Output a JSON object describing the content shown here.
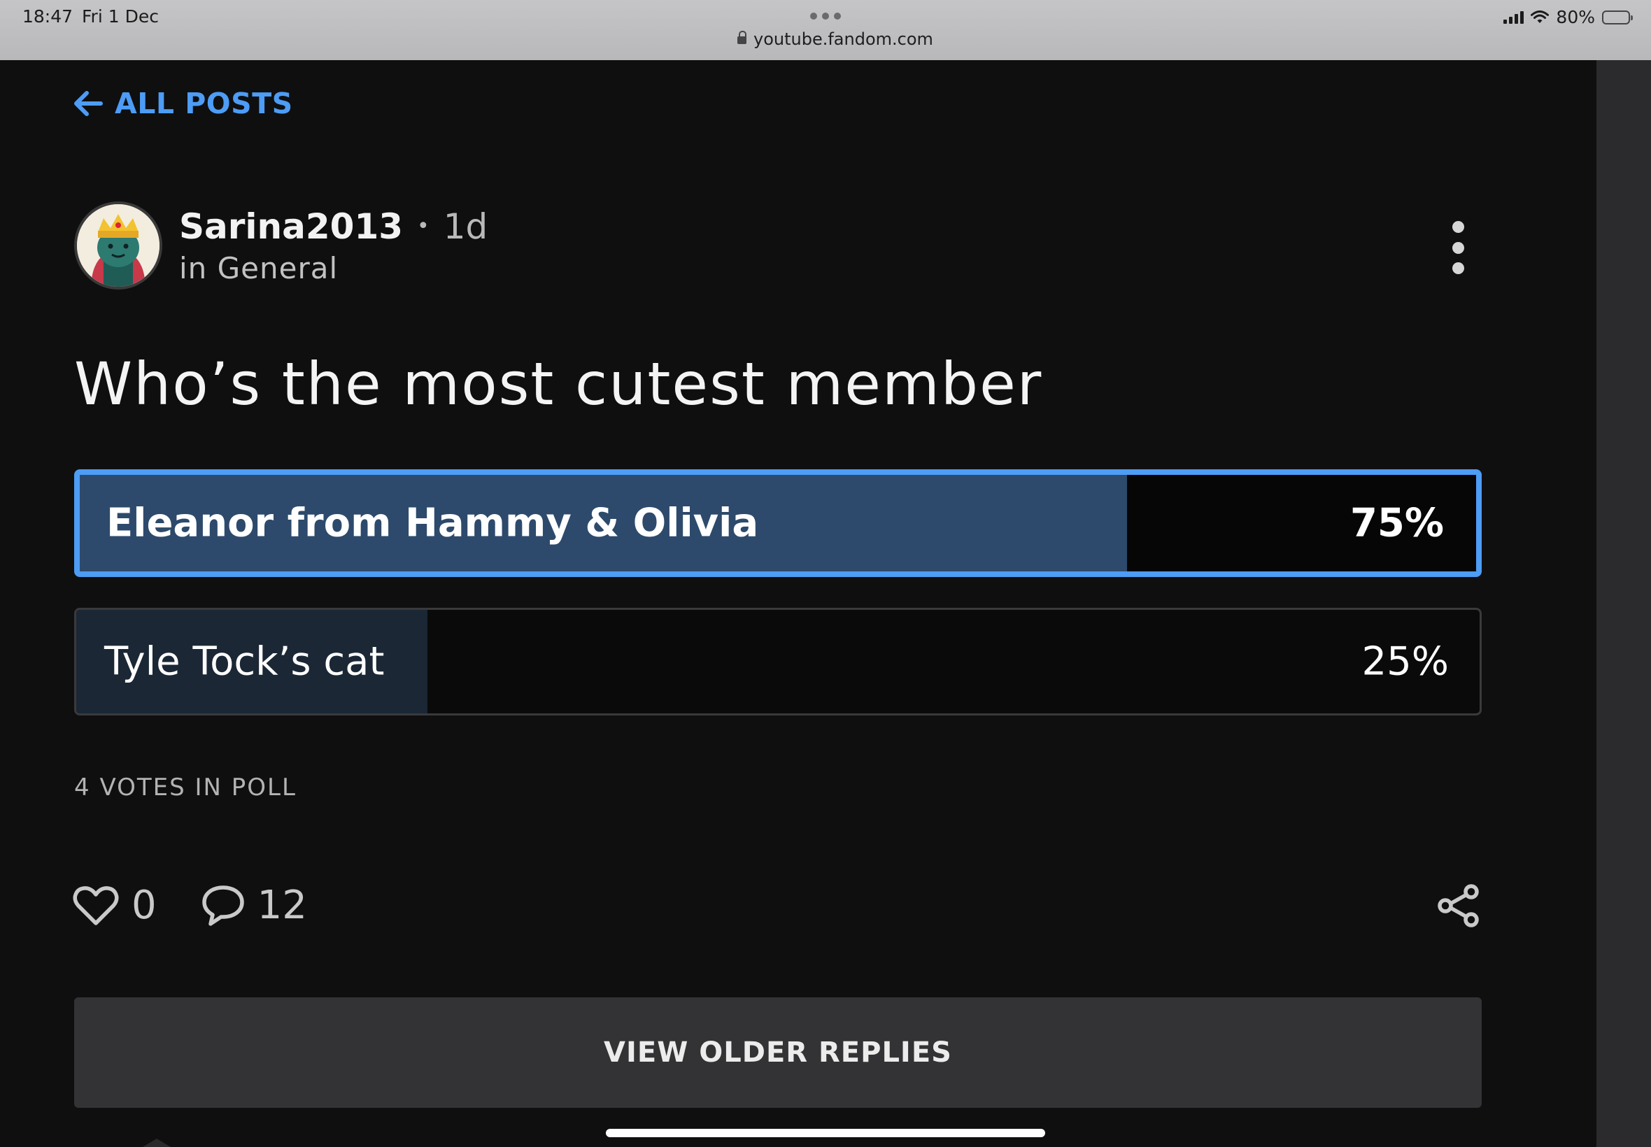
{
  "status_bar": {
    "time": "18:47",
    "date": "Fri 1 Dec",
    "url": "youtube.fandom.com",
    "battery": "80%",
    "battery_level": 0.8
  },
  "nav": {
    "back_label": "ALL POSTS",
    "back_icon": "arrow-left-icon"
  },
  "post": {
    "author": "Sarina2013",
    "separator": "•",
    "age": "1d",
    "category": "in General",
    "title": "Who’s the most cutest member",
    "menu_icon": "more-vertical-icon"
  },
  "poll": {
    "options": [
      {
        "label": "Eleanor from Hammy & Olivia",
        "percent_label": "75%",
        "fraction": 0.75,
        "selected": true
      },
      {
        "label": "Tyle Tock’s cat",
        "percent_label": "25%",
        "fraction": 0.25,
        "selected": false
      }
    ],
    "votes_label": "4 VOTES IN POLL"
  },
  "actions": {
    "likes": "0",
    "replies": "12",
    "like_icon": "heart-icon",
    "reply_icon": "comment-icon",
    "share_icon": "share-icon"
  },
  "footer": {
    "older_replies_label": "VIEW OLDER REPLIES"
  },
  "colors": {
    "accent": "#4d9cf5",
    "background": "#0f0f10",
    "selected_fill": "#2d4a6c",
    "unselected_fill": "#1b2735",
    "button_bg": "#333335"
  }
}
